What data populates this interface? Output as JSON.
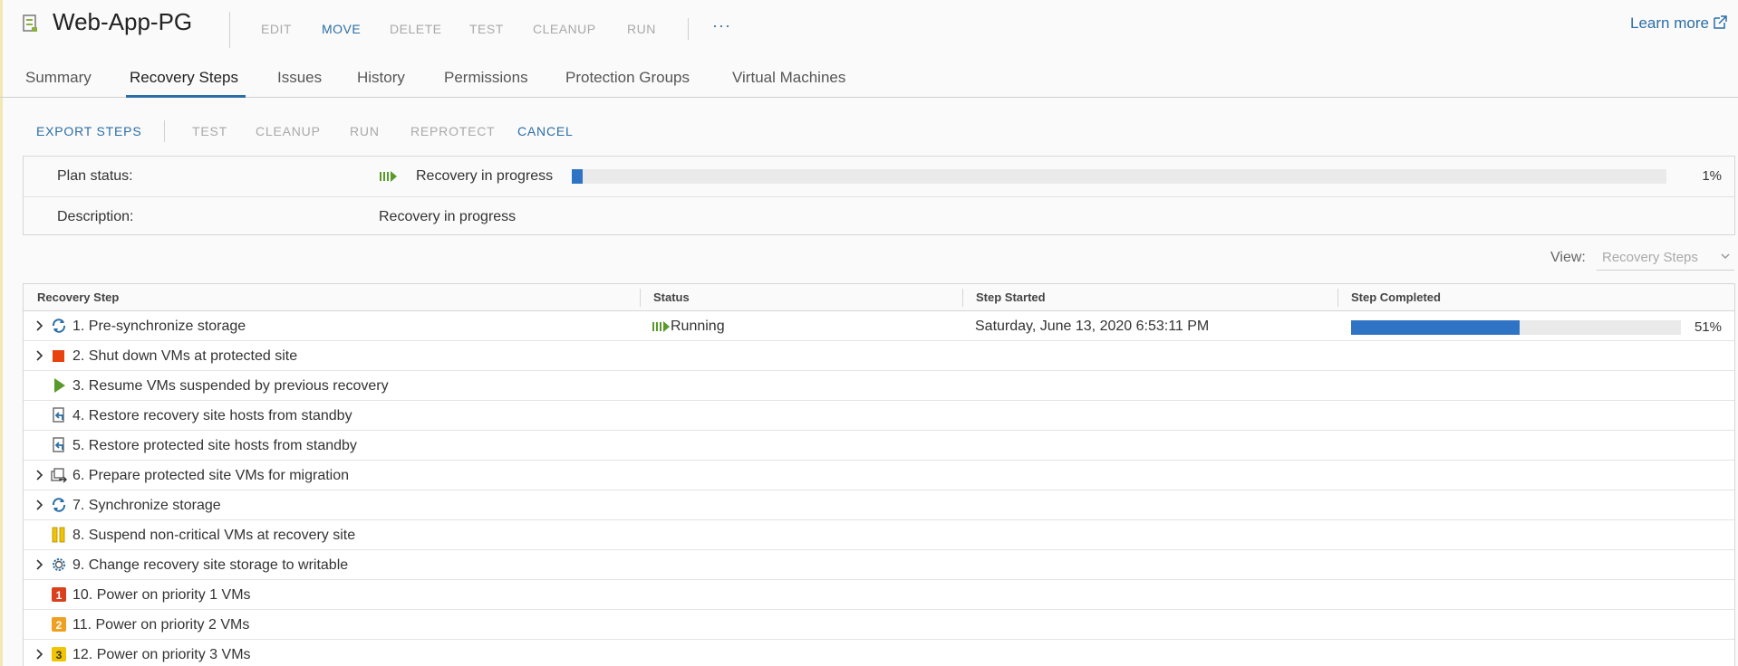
{
  "header": {
    "title": "Web-App-PG",
    "actions": [
      {
        "label": "EDIT",
        "enabled": false
      },
      {
        "label": "MOVE",
        "enabled": true
      },
      {
        "label": "DELETE",
        "enabled": false
      },
      {
        "label": "TEST",
        "enabled": false
      },
      {
        "label": "CLEANUP",
        "enabled": false
      },
      {
        "label": "RUN",
        "enabled": false
      }
    ],
    "more_label": "···",
    "learn_more": "Learn more"
  },
  "tabs": [
    {
      "label": "Summary",
      "active": false
    },
    {
      "label": "Recovery Steps",
      "active": true
    },
    {
      "label": "Issues",
      "active": false
    },
    {
      "label": "History",
      "active": false
    },
    {
      "label": "Permissions",
      "active": false
    },
    {
      "label": "Protection Groups",
      "active": false
    },
    {
      "label": "Virtual Machines",
      "active": false
    }
  ],
  "toolbar": [
    {
      "label": "EXPORT STEPS",
      "enabled": true
    },
    {
      "label": "TEST",
      "enabled": false
    },
    {
      "label": "CLEANUP",
      "enabled": false
    },
    {
      "label": "RUN",
      "enabled": false
    },
    {
      "label": "REPROTECT",
      "enabled": false
    },
    {
      "label": "CANCEL",
      "enabled": true
    }
  ],
  "plan": {
    "status_label": "Plan status:",
    "status_value": "Recovery in progress",
    "progress_percent": 1,
    "progress_text": "1%",
    "description_label": "Description:",
    "description_value": "Recovery in progress"
  },
  "view": {
    "label": "View:",
    "selected": "Recovery Steps"
  },
  "grid": {
    "columns": [
      "Recovery Step",
      "Status",
      "Step Started",
      "Step Completed"
    ],
    "rows": [
      {
        "name": "1. Pre-synchronize storage",
        "icon": "sync-icon",
        "expandable": true,
        "status": "Running",
        "started": "Saturday, June 13, 2020 6:53:11 PM",
        "progress_percent": 51,
        "progress_text": "51%"
      },
      {
        "name": "2. Shut down VMs at protected site",
        "icon": "stop-icon",
        "expandable": true,
        "status": "",
        "started": "",
        "progress_text": ""
      },
      {
        "name": "3. Resume VMs suspended by previous recovery",
        "icon": "play-icon",
        "expandable": false,
        "status": "",
        "started": "",
        "progress_text": ""
      },
      {
        "name": "4. Restore recovery site hosts from standby",
        "icon": "host-restore-icon",
        "expandable": false,
        "status": "",
        "started": "",
        "progress_text": ""
      },
      {
        "name": "5. Restore protected site hosts from standby",
        "icon": "host-restore-icon",
        "expandable": false,
        "status": "",
        "started": "",
        "progress_text": ""
      },
      {
        "name": "6. Prepare protected site VMs for migration",
        "icon": "vm-migrate-icon",
        "expandable": true,
        "status": "",
        "started": "",
        "progress_text": ""
      },
      {
        "name": "7. Synchronize storage",
        "icon": "sync-icon",
        "expandable": true,
        "status": "",
        "started": "",
        "progress_text": ""
      },
      {
        "name": "8. Suspend non-critical VMs at recovery site",
        "icon": "pause-icon",
        "expandable": false,
        "status": "",
        "started": "",
        "progress_text": ""
      },
      {
        "name": "9. Change recovery site storage to writable",
        "icon": "gear-icon",
        "expandable": true,
        "status": "",
        "started": "",
        "progress_text": ""
      },
      {
        "name": "10. Power on priority 1 VMs",
        "icon": "priority-1-icon",
        "badge": "1",
        "badge_color": "#d9411e",
        "expandable": false,
        "status": "",
        "started": "",
        "progress_text": ""
      },
      {
        "name": "11. Power on priority 2 VMs",
        "icon": "priority-2-icon",
        "badge": "2",
        "badge_color": "#efa020",
        "expandable": false,
        "status": "",
        "started": "",
        "progress_text": ""
      },
      {
        "name": "12. Power on priority 3 VMs",
        "icon": "priority-3-icon",
        "badge": "3",
        "badge_color": "#f2c400",
        "expandable": true,
        "status": "",
        "started": "",
        "progress_text": ""
      }
    ]
  },
  "colors": {
    "accent": "#2b6ea6",
    "progress": "#2f73c4",
    "running": "#5a9a2a",
    "stop": "#e8420e"
  }
}
